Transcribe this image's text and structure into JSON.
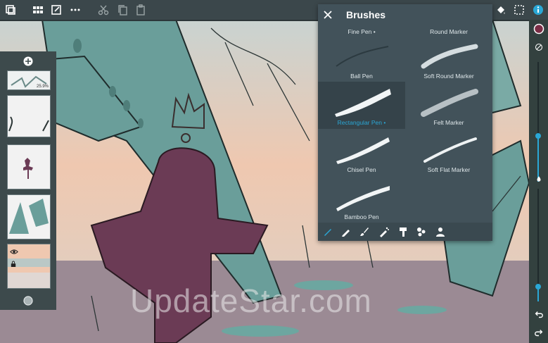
{
  "toolbar": {
    "icons": [
      "layers-icon",
      "grid-icon",
      "edit-icon",
      "more-icon",
      "cut-icon",
      "copy-icon",
      "paste-icon",
      "fill-icon",
      "select-icon",
      "info-icon"
    ]
  },
  "brush_panel": {
    "title": "Brushes",
    "close_icon": "close-icon",
    "brushes": [
      {
        "label": "Fine Pen •",
        "selected": false
      },
      {
        "label": "Round Marker",
        "selected": false
      },
      {
        "label": "Ball Pen",
        "selected": false
      },
      {
        "label": "Soft Round Marker",
        "selected": false
      },
      {
        "label": "Rectangular Pen •",
        "selected": true
      },
      {
        "label": "Felt Marker",
        "selected": false
      },
      {
        "label": "Chisel Pen",
        "selected": false
      },
      {
        "label": "Soft Flat Marker",
        "selected": false
      },
      {
        "label": "Bamboo Pen",
        "selected": false
      }
    ],
    "categories": [
      "pencil-icon",
      "pen-icon",
      "brush-icon",
      "airbrush-icon",
      "marker-icon",
      "texture-icon",
      "person-icon"
    ]
  },
  "layers": {
    "add_icon": "add-icon",
    "items": [
      {
        "name": "layer-1",
        "opacity": "25.9%"
      },
      {
        "name": "layer-2"
      },
      {
        "name": "layer-3"
      },
      {
        "name": "layer-4"
      },
      {
        "name": "layer-5",
        "active": true
      }
    ],
    "color_indicator": "color-dot"
  },
  "right_sidebar": {
    "color": "#ffffff",
    "icons": [
      "color-swatch-icon",
      "reset-icon",
      "opacity-icon",
      "undo-icon",
      "redo-icon"
    ],
    "size_level": 0.38,
    "opacity_level": 0.13
  },
  "watermark": "UpdateStar.com",
  "colors": {
    "accent": "#2aa7d6",
    "figure": "#6b3b55"
  }
}
